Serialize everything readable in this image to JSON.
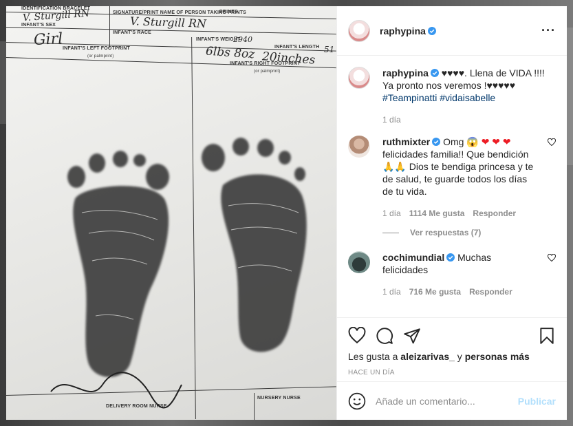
{
  "post": {
    "author": "raphypina",
    "caption_text": "♥♥♥♥. Llena de VIDA !!!! Ya pronto nos veremos !♥♥♥♥♥",
    "hashtags": "#Teampinatti #vidaisabelle",
    "caption_time": "1 día"
  },
  "photo": {
    "form": {
      "identification_bracelet": "IDENTIFICATION BRACELET",
      "prints": "PRINTS",
      "signature": "SIGNATURE/PRINT NAME OF PERSON TAKING PRINTS",
      "infants_sex": "INFANT'S SEX",
      "infants_race": "INFANT'S RACE",
      "infants_weight": "INFANT'S WEIGHT",
      "infants_length": "INFANT'S LENGTH",
      "left_footprint": "INFANT'S LEFT FOOTPRINT",
      "left_palm": "(or palmprint)",
      "right_footprint": "INFANT'S RIGHT FOOTPRINT",
      "right_palm": "(or palmprint)",
      "delivery_nurse": "DELIVERY ROOM NURSE",
      "nursery_nurse": "NURSERY NURSE"
    },
    "handwriting": {
      "bracelet": "V. Sturgill RN",
      "sex": "Girl",
      "signature": "V. Sturgill RN",
      "weight": "6lbs 8oz",
      "time": "2940",
      "length": "20inches",
      "length_cut": "51"
    }
  },
  "comments": [
    {
      "user": "ruthmixter",
      "text_start": "Omg",
      "emoji_scream": "😱",
      "hearts": "❤ ❤ ❤",
      "text_rest": "felicidades familia!! Que bendición",
      "emoji_pray": "🙏🙏",
      "text_end": "Dios te bendiga princesa y te de salud, te guarde todos los días de tu vida.",
      "time": "1 día",
      "likes": "1114 Me gusta",
      "reply": "Responder",
      "view_replies": "Ver respuestas (7)"
    },
    {
      "user": "cochimundial",
      "text": "Muchas felicidades",
      "time": "1 día",
      "likes": "716 Me gusta",
      "reply": "Responder"
    }
  ],
  "footer": {
    "likes_prefix": "Les gusta a",
    "liker": "aleizarivas_",
    "likes_join": "y",
    "likes_others": "personas más",
    "timestamp": "HACE UN DÍA",
    "comment_placeholder": "Añade un comentario...",
    "publish_label": "Publicar"
  },
  "colors": {
    "verified": "#3897f0",
    "heart_red": "#ed1c24",
    "link": "#00376b",
    "publish_disabled": "#b2dffc"
  }
}
